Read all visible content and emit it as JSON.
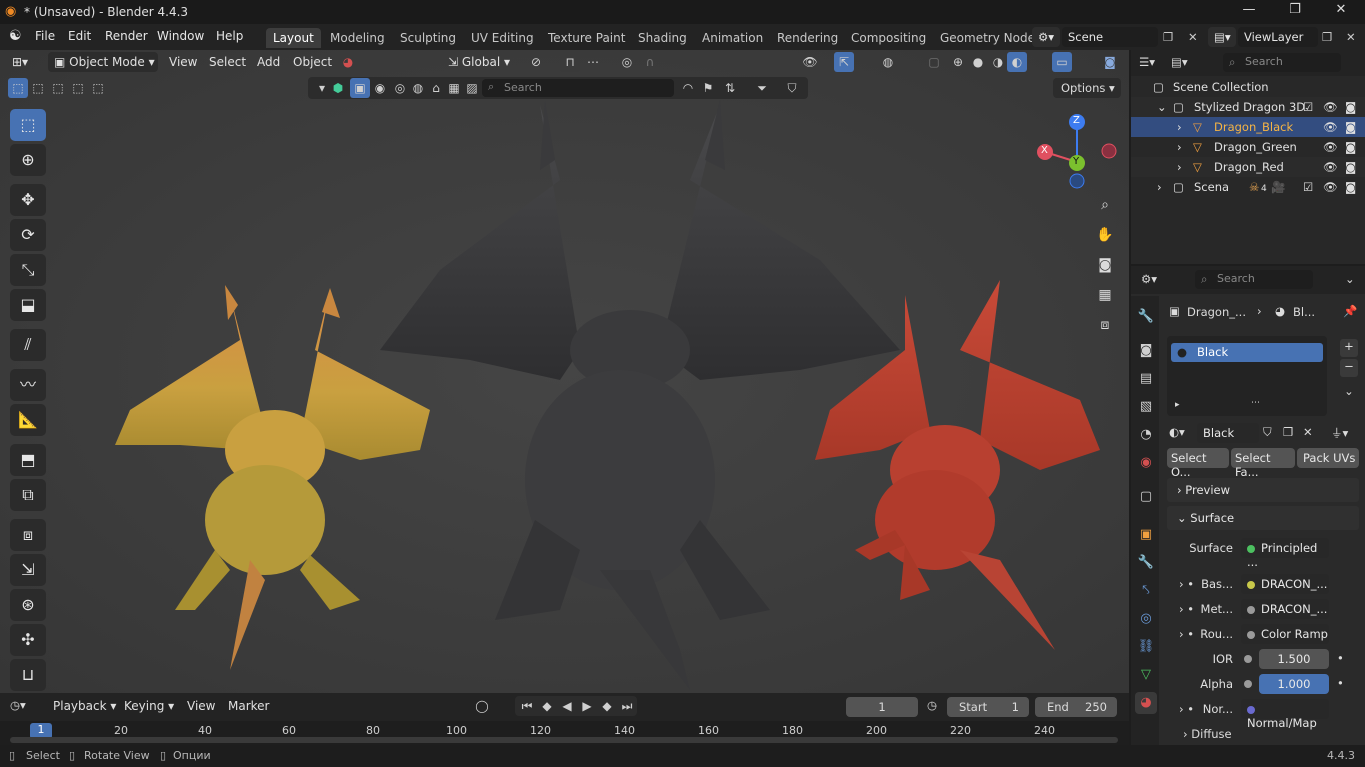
{
  "window": {
    "title": "* (Unsaved) - Blender 4.4.3",
    "controls": [
      "—",
      "❐",
      "✕"
    ]
  },
  "menu": [
    "File",
    "Edit",
    "Render",
    "Window",
    "Help"
  ],
  "workspaces": [
    "Layout",
    "Modeling",
    "Sculpting",
    "UV Editing",
    "Texture Paint",
    "Shading",
    "Animation",
    "Rendering",
    "Compositing",
    "Geometry Node"
  ],
  "active_workspace": "Layout",
  "scene": {
    "name": "Scene",
    "view_layer": "ViewLayer"
  },
  "viewport_header": {
    "mode": "Object Mode",
    "menus": [
      "View",
      "Select",
      "Add",
      "Object"
    ],
    "orientation": "Global",
    "search_placeholder": "Search",
    "options": "Options"
  },
  "gizmo": {
    "x": "X",
    "y": "Y",
    "z": "Z"
  },
  "timeline": {
    "menus": [
      "Playback",
      "Keying",
      "View",
      "Marker"
    ],
    "current_frame": "1",
    "start_label": "Start",
    "start": "1",
    "end_label": "End",
    "end": "250",
    "ticks": [
      "1",
      "20",
      "40",
      "60",
      "80",
      "100",
      "120",
      "140",
      "160",
      "180",
      "200",
      "220",
      "240"
    ]
  },
  "status": {
    "select": "Select",
    "rotate": "Rotate View",
    "options": "Опции",
    "version": "4.4.3"
  },
  "outliner": {
    "search_placeholder": "Search",
    "root": "Scene Collection",
    "collection": "Stylized Dragon 3D",
    "items": [
      "Dragon_Black",
      "Dragon_Green",
      "Dragon_Red"
    ],
    "scene_item": "Scena",
    "scene_badge": "4"
  },
  "properties": {
    "search_placeholder": "Search",
    "breadcrumb_obj": "Dragon_...",
    "breadcrumb_mat": "Bl...",
    "slot": "Black",
    "material_name": "Black",
    "buttons": [
      "Select O...",
      "Select Fa...",
      "Pack UVs"
    ],
    "panels": {
      "preview": "Preview",
      "surface": "Surface",
      "diffuse": "Diffuse"
    },
    "surface_label": "Surface",
    "surface_value": "Principled ...",
    "rows": [
      {
        "label": "Bas...",
        "value": "DRACON_...",
        "color": "#c8c84a"
      },
      {
        "label": "Met...",
        "value": "DRACON_...",
        "color": "#9a9a9a"
      },
      {
        "label": "Rou...",
        "value": "Color Ramp",
        "color": "#9a9a9a"
      },
      {
        "label": "IOR",
        "value": "1.500",
        "color": "#9a9a9a"
      },
      {
        "label": "Alpha",
        "value": "1.000",
        "color": "#9a9a9a"
      },
      {
        "label": "Nor...",
        "value": "Normal/Map",
        "color": "#6a6ad0"
      }
    ]
  }
}
